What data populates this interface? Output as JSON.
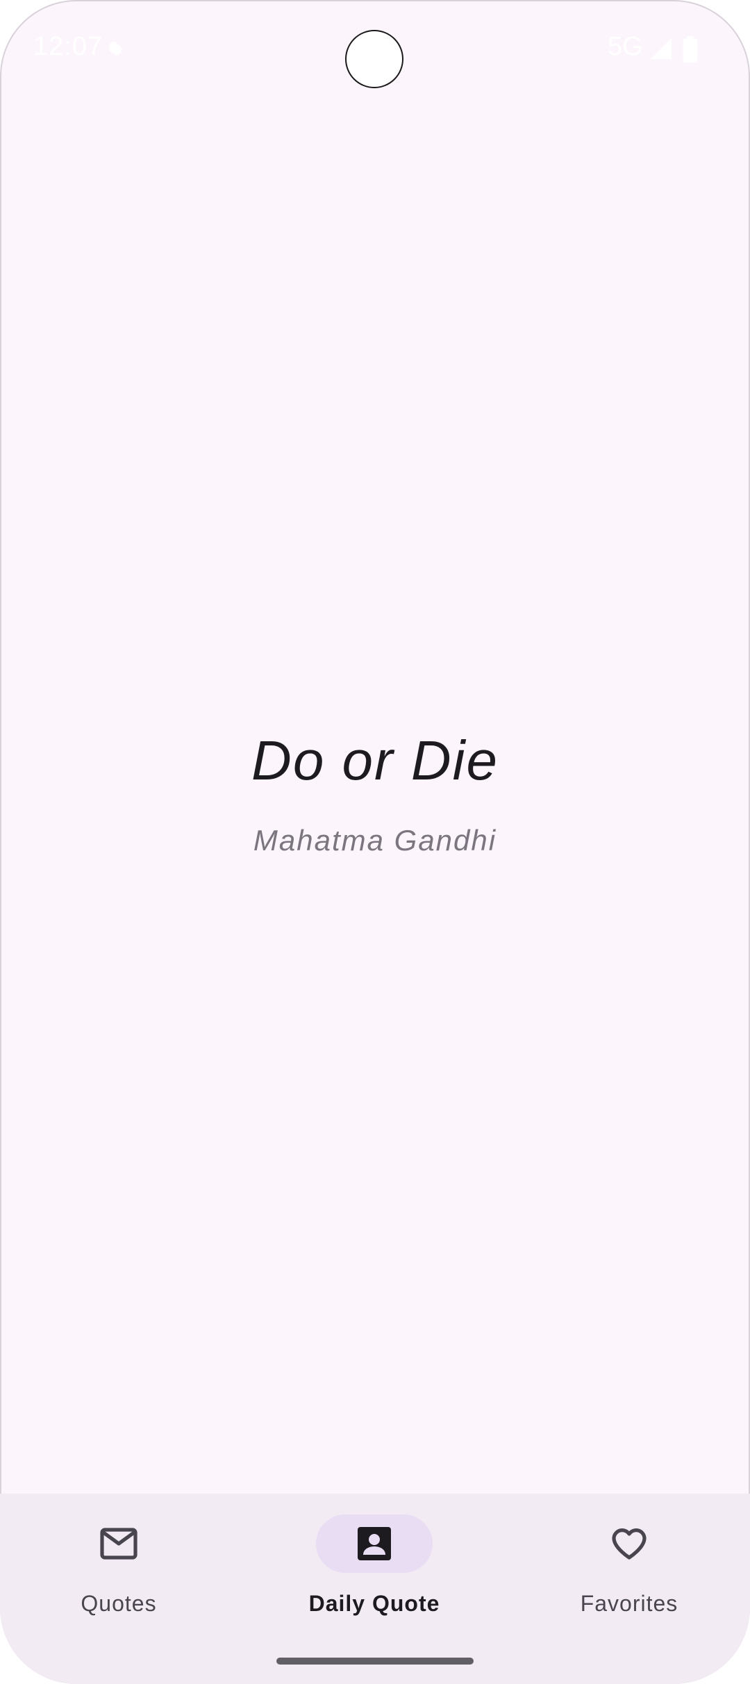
{
  "status_bar": {
    "time": "12:07",
    "network": "5G"
  },
  "quote": {
    "text": "Do or Die",
    "author": "Mahatma Gandhi"
  },
  "bottom_nav": {
    "items": [
      {
        "label": "Quotes",
        "icon": "mail-icon",
        "active": false
      },
      {
        "label": "Daily Quote",
        "icon": "account-box-icon",
        "active": true
      },
      {
        "label": "Favorites",
        "icon": "heart-outline-icon",
        "active": false
      }
    ]
  },
  "colors": {
    "background": "#fcf5fc",
    "nav_background": "#f2ebf4",
    "active_indicator": "#e8ddf3",
    "quote_text": "#1d1b20",
    "author_text": "#7a757f"
  }
}
